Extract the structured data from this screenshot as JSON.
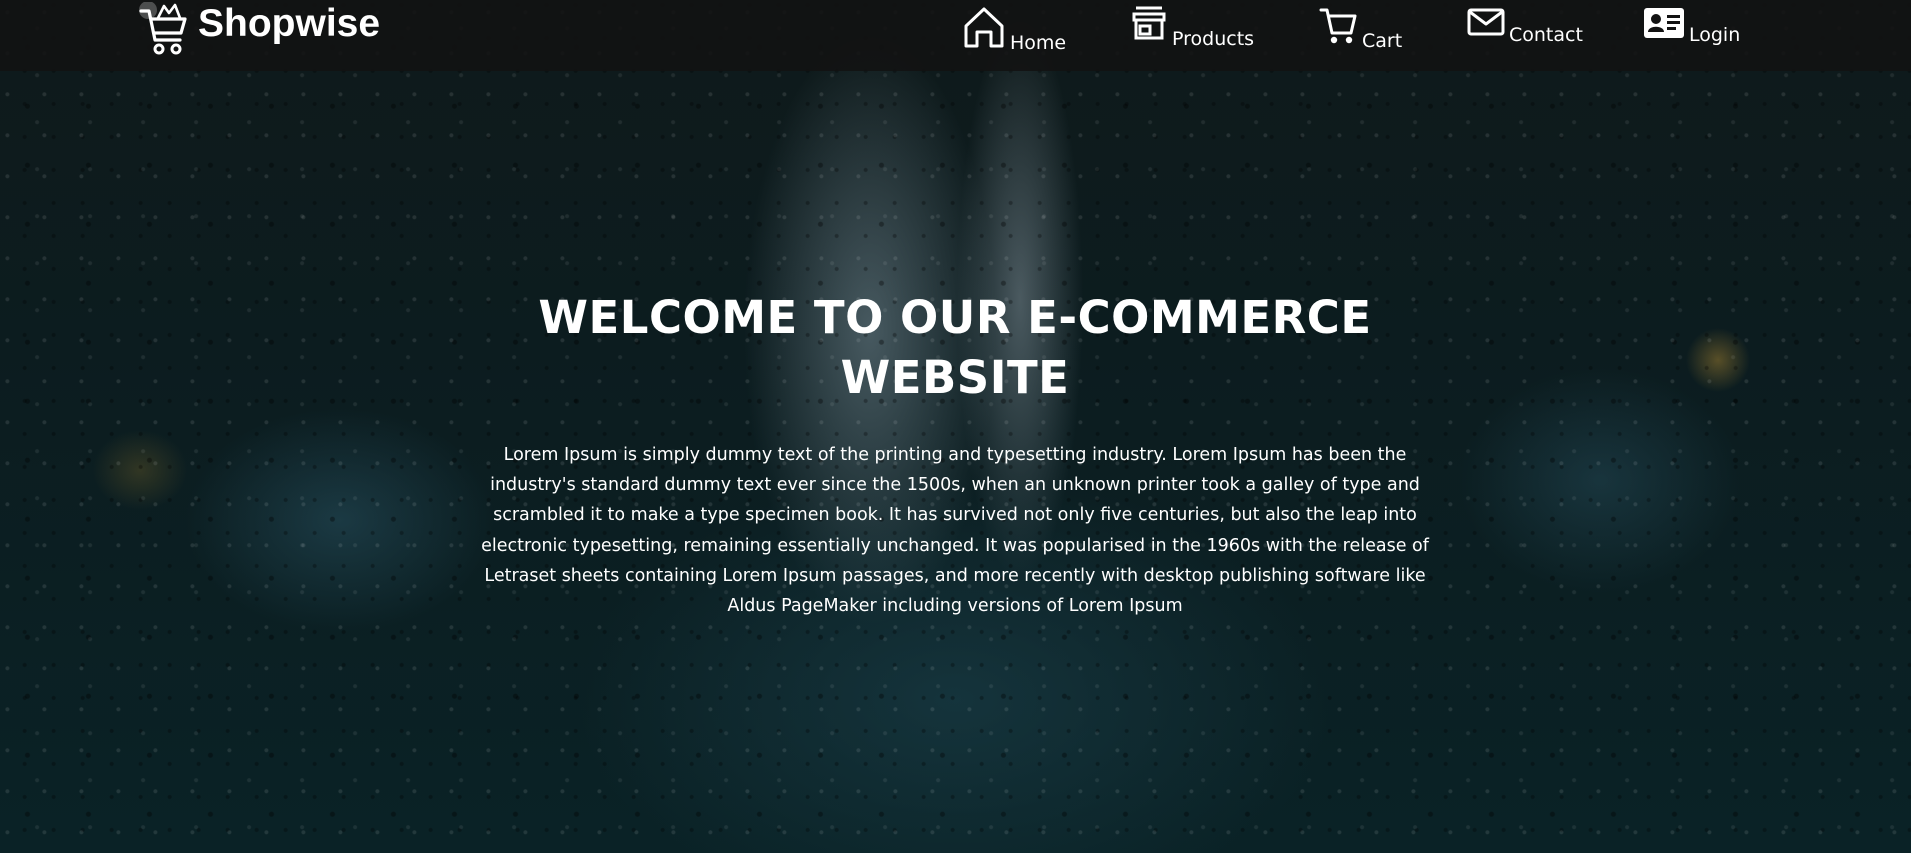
{
  "brand": {
    "name": "Shopwise",
    "icon": "shopping-cart-icon"
  },
  "nav": {
    "items": [
      {
        "label": "Home",
        "icon": "home-icon"
      },
      {
        "label": "Products",
        "icon": "store-icon"
      },
      {
        "label": "Cart",
        "icon": "cart-icon"
      },
      {
        "label": "Contact",
        "icon": "envelope-icon"
      },
      {
        "label": "Login",
        "icon": "id-card-icon"
      }
    ]
  },
  "hero": {
    "title": "WELCOME TO OUR E-COMMERCE WEBSITE",
    "description": "Lorem Ipsum is simply dummy text of the printing and typesetting industry. Lorem Ipsum has been the industry's standard dummy text ever since the 1500s, when an unknown printer took a galley of type and scrambled it to make a type specimen book. It has survived not only five centuries, but also the leap into electronic typesetting, remaining essentially unchanged. It was popularised in the 1960s with the release of Letraset sheets containing Lorem Ipsum passages, and more recently with desktop publishing software like Aldus PageMaker including versions of Lorem Ipsum"
  },
  "colors": {
    "navbar_bg": "#121212",
    "text": "#ffffff",
    "hero_bg": "#0b1a1c"
  }
}
